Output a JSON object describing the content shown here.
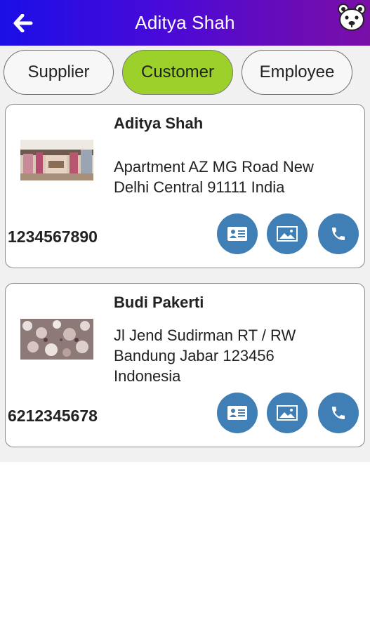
{
  "header": {
    "title": "Aditya Shah",
    "back_icon": "arrow-left-icon",
    "avatar_icon": "bear-face-icon",
    "gradient_colors": [
      "#1a0fe6",
      "#7a0fa8"
    ]
  },
  "tabs": [
    {
      "label": "Supplier",
      "active": false
    },
    {
      "label": "Customer",
      "active": true
    },
    {
      "label": "Employee",
      "active": false
    }
  ],
  "colors": {
    "active_tab": "#9cd12c",
    "action_button": "#3f7fb5",
    "background": "#f1f1f1"
  },
  "contacts": [
    {
      "name": "Aditya Shah",
      "address": "Apartment AZ MG Road New Delhi Central 91111 India",
      "phone": "1234567890",
      "image": "store-interior-photo",
      "actions": [
        "id-card-icon",
        "image-icon",
        "phone-icon"
      ]
    },
    {
      "name": "Budi Pakerti",
      "address": "Jl Jend Sudirman RT / RW Bandung Jabar 123456 Indonesia",
      "phone": "6212345678",
      "image": "floral-pattern-photo",
      "actions": [
        "id-card-icon",
        "image-icon",
        "phone-icon"
      ]
    }
  ]
}
